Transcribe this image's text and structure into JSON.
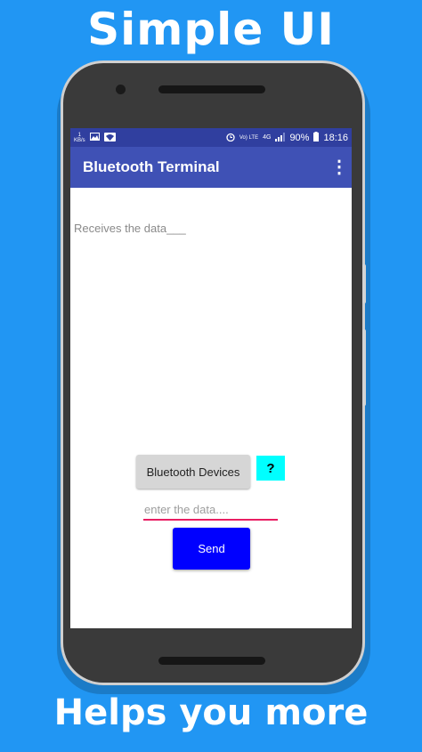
{
  "promo": {
    "top_text": "Simple UI",
    "bottom_text": "Helps you more"
  },
  "status_bar": {
    "speed_value": "1",
    "speed_unit": "KB/s",
    "lte_label": "Vo) LTE",
    "network_label": "4G",
    "battery_percent": "90%",
    "time": "18:16",
    "icons": [
      "image-icon",
      "wifi-icon",
      "alarm-icon",
      "signal-icon",
      "battery-icon"
    ]
  },
  "app_bar": {
    "title": "Bluetooth Terminal",
    "menu_icon": "overflow-menu-icon"
  },
  "main": {
    "received_text": "Receives the data___",
    "bluetooth_button_label": "Bluetooth Devices",
    "help_button_label": "?",
    "input_placeholder": "enter the data....",
    "input_value": "",
    "send_button_label": "Send"
  },
  "colors": {
    "background": "#2196f3",
    "status_bar": "#303f9f",
    "app_bar": "#3f51b5",
    "help_button": "#00ffff",
    "send_button": "#0000ff",
    "input_underline": "#e91e63"
  }
}
